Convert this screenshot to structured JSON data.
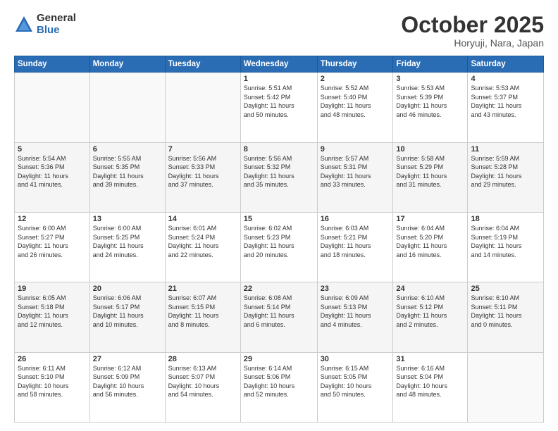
{
  "logo": {
    "general": "General",
    "blue": "Blue"
  },
  "title": "October 2025",
  "location": "Horyuji, Nara, Japan",
  "days_of_week": [
    "Sunday",
    "Monday",
    "Tuesday",
    "Wednesday",
    "Thursday",
    "Friday",
    "Saturday"
  ],
  "weeks": [
    [
      {
        "day": "",
        "info": ""
      },
      {
        "day": "",
        "info": ""
      },
      {
        "day": "",
        "info": ""
      },
      {
        "day": "1",
        "info": "Sunrise: 5:51 AM\nSunset: 5:42 PM\nDaylight: 11 hours\nand 50 minutes."
      },
      {
        "day": "2",
        "info": "Sunrise: 5:52 AM\nSunset: 5:40 PM\nDaylight: 11 hours\nand 48 minutes."
      },
      {
        "day": "3",
        "info": "Sunrise: 5:53 AM\nSunset: 5:39 PM\nDaylight: 11 hours\nand 46 minutes."
      },
      {
        "day": "4",
        "info": "Sunrise: 5:53 AM\nSunset: 5:37 PM\nDaylight: 11 hours\nand 43 minutes."
      }
    ],
    [
      {
        "day": "5",
        "info": "Sunrise: 5:54 AM\nSunset: 5:36 PM\nDaylight: 11 hours\nand 41 minutes."
      },
      {
        "day": "6",
        "info": "Sunrise: 5:55 AM\nSunset: 5:35 PM\nDaylight: 11 hours\nand 39 minutes."
      },
      {
        "day": "7",
        "info": "Sunrise: 5:56 AM\nSunset: 5:33 PM\nDaylight: 11 hours\nand 37 minutes."
      },
      {
        "day": "8",
        "info": "Sunrise: 5:56 AM\nSunset: 5:32 PM\nDaylight: 11 hours\nand 35 minutes."
      },
      {
        "day": "9",
        "info": "Sunrise: 5:57 AM\nSunset: 5:31 PM\nDaylight: 11 hours\nand 33 minutes."
      },
      {
        "day": "10",
        "info": "Sunrise: 5:58 AM\nSunset: 5:29 PM\nDaylight: 11 hours\nand 31 minutes."
      },
      {
        "day": "11",
        "info": "Sunrise: 5:59 AM\nSunset: 5:28 PM\nDaylight: 11 hours\nand 29 minutes."
      }
    ],
    [
      {
        "day": "12",
        "info": "Sunrise: 6:00 AM\nSunset: 5:27 PM\nDaylight: 11 hours\nand 26 minutes."
      },
      {
        "day": "13",
        "info": "Sunrise: 6:00 AM\nSunset: 5:25 PM\nDaylight: 11 hours\nand 24 minutes."
      },
      {
        "day": "14",
        "info": "Sunrise: 6:01 AM\nSunset: 5:24 PM\nDaylight: 11 hours\nand 22 minutes."
      },
      {
        "day": "15",
        "info": "Sunrise: 6:02 AM\nSunset: 5:23 PM\nDaylight: 11 hours\nand 20 minutes."
      },
      {
        "day": "16",
        "info": "Sunrise: 6:03 AM\nSunset: 5:21 PM\nDaylight: 11 hours\nand 18 minutes."
      },
      {
        "day": "17",
        "info": "Sunrise: 6:04 AM\nSunset: 5:20 PM\nDaylight: 11 hours\nand 16 minutes."
      },
      {
        "day": "18",
        "info": "Sunrise: 6:04 AM\nSunset: 5:19 PM\nDaylight: 11 hours\nand 14 minutes."
      }
    ],
    [
      {
        "day": "19",
        "info": "Sunrise: 6:05 AM\nSunset: 5:18 PM\nDaylight: 11 hours\nand 12 minutes."
      },
      {
        "day": "20",
        "info": "Sunrise: 6:06 AM\nSunset: 5:17 PM\nDaylight: 11 hours\nand 10 minutes."
      },
      {
        "day": "21",
        "info": "Sunrise: 6:07 AM\nSunset: 5:15 PM\nDaylight: 11 hours\nand 8 minutes."
      },
      {
        "day": "22",
        "info": "Sunrise: 6:08 AM\nSunset: 5:14 PM\nDaylight: 11 hours\nand 6 minutes."
      },
      {
        "day": "23",
        "info": "Sunrise: 6:09 AM\nSunset: 5:13 PM\nDaylight: 11 hours\nand 4 minutes."
      },
      {
        "day": "24",
        "info": "Sunrise: 6:10 AM\nSunset: 5:12 PM\nDaylight: 11 hours\nand 2 minutes."
      },
      {
        "day": "25",
        "info": "Sunrise: 6:10 AM\nSunset: 5:11 PM\nDaylight: 11 hours\nand 0 minutes."
      }
    ],
    [
      {
        "day": "26",
        "info": "Sunrise: 6:11 AM\nSunset: 5:10 PM\nDaylight: 10 hours\nand 58 minutes."
      },
      {
        "day": "27",
        "info": "Sunrise: 6:12 AM\nSunset: 5:09 PM\nDaylight: 10 hours\nand 56 minutes."
      },
      {
        "day": "28",
        "info": "Sunrise: 6:13 AM\nSunset: 5:07 PM\nDaylight: 10 hours\nand 54 minutes."
      },
      {
        "day": "29",
        "info": "Sunrise: 6:14 AM\nSunset: 5:06 PM\nDaylight: 10 hours\nand 52 minutes."
      },
      {
        "day": "30",
        "info": "Sunrise: 6:15 AM\nSunset: 5:05 PM\nDaylight: 10 hours\nand 50 minutes."
      },
      {
        "day": "31",
        "info": "Sunrise: 6:16 AM\nSunset: 5:04 PM\nDaylight: 10 hours\nand 48 minutes."
      },
      {
        "day": "",
        "info": ""
      }
    ]
  ]
}
